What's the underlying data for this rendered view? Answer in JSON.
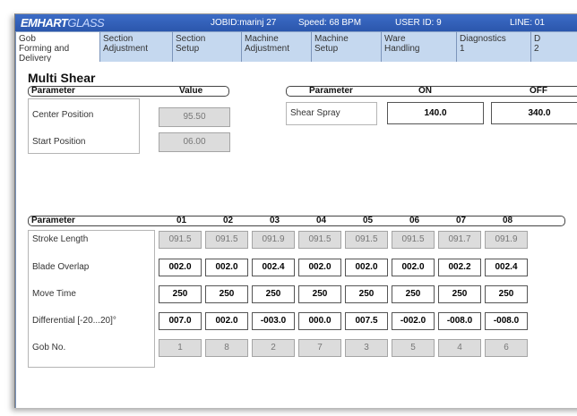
{
  "header": {
    "brand_bold": "EMHART",
    "brand_light": "GLASS",
    "jobid": "JOBID:marinj 27",
    "speed": "Speed: 68 BPM",
    "user": "USER ID: 9",
    "line": "LINE: 01"
  },
  "tabs": [
    {
      "label": "Gob\nForming and\nDelivery",
      "active": true
    },
    {
      "label": "Section\nAdjustment"
    },
    {
      "label": "Section\nSetup"
    },
    {
      "label": "Machine\nAdjustment"
    },
    {
      "label": "Machine\nSetup"
    },
    {
      "label": "Ware\nHandling"
    },
    {
      "label": "Diagnostics\n1"
    },
    {
      "label": "D\n2"
    }
  ],
  "page_title": "Multi Shear",
  "upper_left": {
    "col_parameter": "Parameter",
    "col_value": "Value",
    "rows": [
      {
        "label": "Center Position",
        "value": "95.50"
      },
      {
        "label": "Start Position",
        "value": "06.00"
      }
    ]
  },
  "upper_right": {
    "col_parameter": "Parameter",
    "col_on": "ON",
    "col_off": "OFF",
    "row_label": "Shear Spray",
    "on_value": "140.0",
    "off_value": "340.0"
  },
  "grid": {
    "col_parameter": "Parameter",
    "columns": [
      "01",
      "02",
      "03",
      "04",
      "05",
      "06",
      "07",
      "08"
    ],
    "rows": [
      {
        "label": "Stroke Length",
        "editable": false,
        "values": [
          "091.5",
          "091.5",
          "091.9",
          "091.5",
          "091.5",
          "091.5",
          "091.7",
          "091.9"
        ]
      },
      {
        "label": "Blade Overlap",
        "editable": true,
        "values": [
          "002.0",
          "002.0",
          "002.4",
          "002.0",
          "002.0",
          "002.0",
          "002.2",
          "002.4"
        ]
      },
      {
        "label": "Move Time",
        "editable": true,
        "values": [
          "250",
          "250",
          "250",
          "250",
          "250",
          "250",
          "250",
          "250"
        ]
      },
      {
        "label": "Differential [-20...20]°",
        "editable": true,
        "values": [
          "007.0",
          "002.0",
          "-003.0",
          "000.0",
          "007.5",
          "-002.0",
          "-008.0",
          "-008.0"
        ]
      },
      {
        "label": "Gob No.",
        "editable": false,
        "values": [
          "1",
          "8",
          "2",
          "7",
          "3",
          "5",
          "4",
          "6"
        ]
      }
    ]
  }
}
